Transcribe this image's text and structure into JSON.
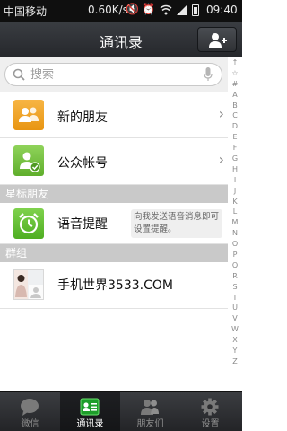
{
  "status_bar": {
    "carrier": "中国移动",
    "speed": "0.60K/s",
    "time": "09:40"
  },
  "header": {
    "title": "通讯录"
  },
  "search": {
    "placeholder": "搜索"
  },
  "rows": {
    "new_friends": "新的朋友",
    "official_accounts": "公众帐号"
  },
  "sections": {
    "starred": "星标朋友",
    "groups": "群组"
  },
  "starred_items": [
    {
      "name": "语音提醒",
      "description": "向我发送语音消息即可设置提醒。"
    }
  ],
  "group_items": [
    {
      "name": "手机世界3533.COM"
    }
  ],
  "index_letters": [
    "↑",
    "☆",
    "#",
    "A",
    "B",
    "C",
    "D",
    "E",
    "F",
    "G",
    "H",
    "I",
    "J",
    "K",
    "L",
    "M",
    "N",
    "O",
    "P",
    "Q",
    "R",
    "S",
    "T",
    "U",
    "V",
    "W",
    "X",
    "Y",
    "Z"
  ],
  "tabs": [
    {
      "label": "微信",
      "icon": "chat-icon",
      "active": false
    },
    {
      "label": "通讯录",
      "icon": "contacts-icon",
      "active": true
    },
    {
      "label": "朋友们",
      "icon": "friends-icon",
      "active": false
    },
    {
      "label": "设置",
      "icon": "gear-icon",
      "active": false
    }
  ],
  "colors": {
    "header_bg": "#2f3135",
    "section_bg": "#c9c9c9",
    "new_friends_icon": "#f0a52a",
    "official_icon": "#77c244",
    "voice_icon": "#64c036"
  }
}
